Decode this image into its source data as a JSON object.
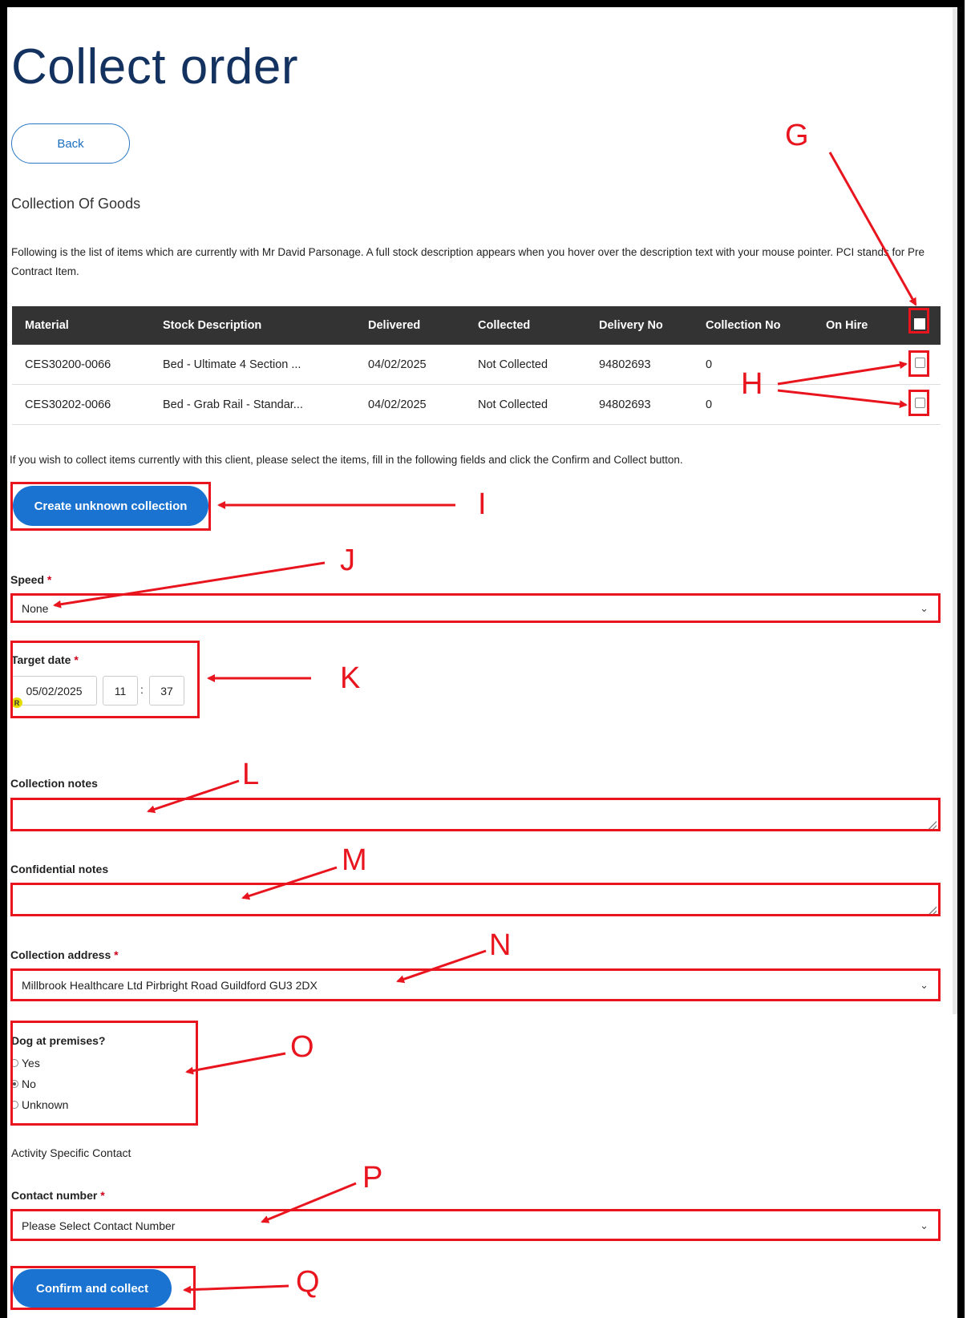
{
  "page": {
    "title": "Collect order"
  },
  "back_label": "Back",
  "section_title": "Collection Of Goods",
  "intro_text": "Following is the list of items which are currently with Mr David Parsonage. A full stock description appears when you hover over the description text with your mouse pointer. PCI stands for Pre Contract Item.",
  "table": {
    "headers": [
      "Material",
      "Stock Description",
      "Delivered",
      "Collected",
      "Delivery No",
      "Collection No",
      "On Hire"
    ],
    "rows": [
      [
        "CES30200-0066",
        "Bed - Ultimate 4 Section ...",
        "04/02/2025",
        "Not Collected",
        "94802693",
        "0",
        ""
      ],
      [
        "CES30202-0066",
        "Bed - Grab Rail - Standar...",
        "04/02/2025",
        "Not Collected",
        "94802693",
        "0",
        ""
      ]
    ]
  },
  "instructions": "If you wish to collect items currently with this client, please select the items, fill in the following fields and click the Confirm and Collect button.",
  "create_unknown_label": "Create unknown collection",
  "speed": {
    "label": "Speed",
    "required": "*",
    "value": "None"
  },
  "target_date": {
    "label": "Target date",
    "required": "*",
    "date": "05/02/2025",
    "hour": "11",
    "sep": ":",
    "minute": "37",
    "icon_letter": "R"
  },
  "collection_notes": {
    "label": "Collection notes"
  },
  "confidential_notes": {
    "label": "Confidential notes"
  },
  "collection_address": {
    "label": "Collection address",
    "required": "*",
    "value": "Millbrook Healthcare Ltd Pirbright Road Guildford GU3 2DX"
  },
  "dog": {
    "label": "Dog at premises?",
    "options": [
      "Yes",
      "No",
      "Unknown"
    ],
    "selected": "No"
  },
  "activity_contact": "Activity Specific Contact",
  "contact_number": {
    "label": "Contact number",
    "required": "*",
    "value": "Please Select Contact Number"
  },
  "confirm_label": "Confirm and collect",
  "callouts": {
    "G": "G",
    "H": "H",
    "I": "I",
    "J": "J",
    "K": "K",
    "L": "L",
    "M": "M",
    "N": "N",
    "O": "O",
    "P": "P",
    "Q": "Q"
  },
  "colors": {
    "annotation_red": "#e8141e",
    "primary_blue": "#1a73d1",
    "title_navy": "#13325f",
    "header_dark": "#333333"
  },
  "icons": {
    "chevron": "chevron-down-icon"
  }
}
